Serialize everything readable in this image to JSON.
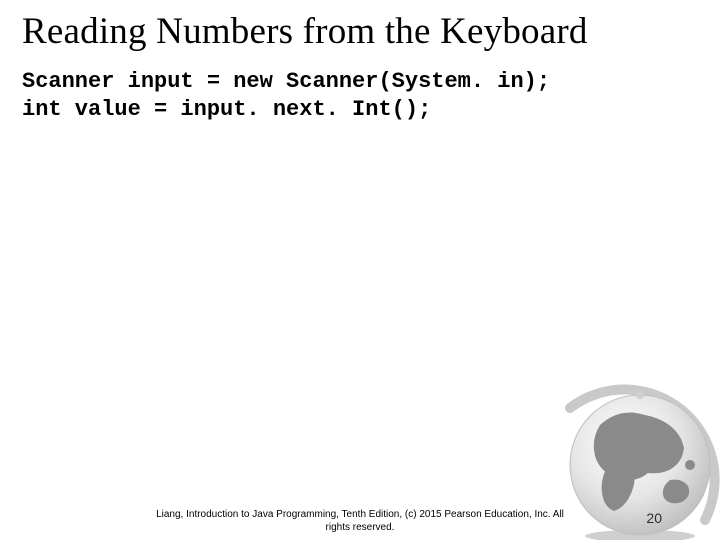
{
  "title": "Reading Numbers from the Keyboard",
  "code_line1": "Scanner input = new Scanner(System. in);",
  "code_line2": "int value = input. next. Int();",
  "footer_line1": "Liang, Introduction to Java Programming, Tenth Edition, (c) 2015 Pearson Education, Inc. All",
  "footer_line2": "rights reserved.",
  "page_number": "20"
}
